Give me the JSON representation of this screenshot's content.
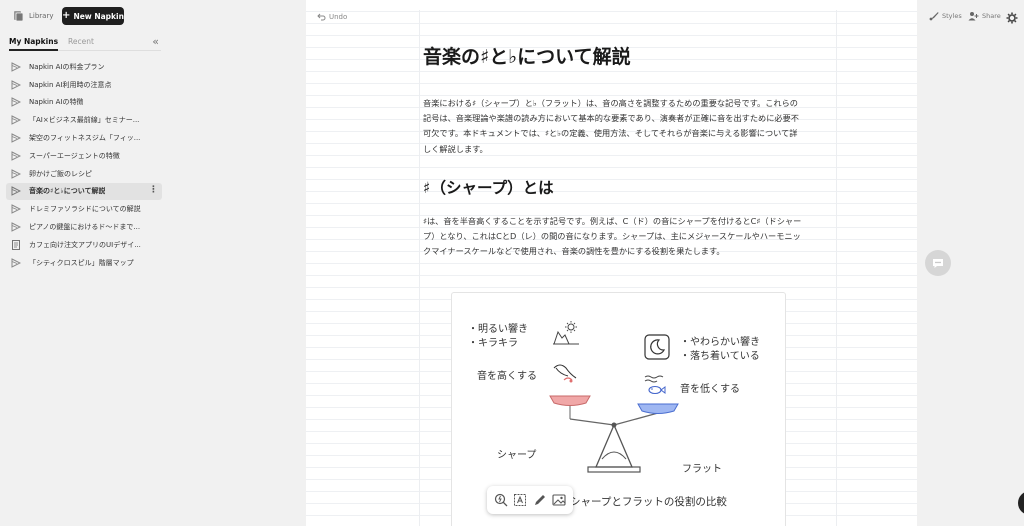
{
  "sidebar": {
    "library_label": "Library",
    "new_napkin_label": "New Napkin",
    "tabs": [
      {
        "label": "My Napkins",
        "active": true
      },
      {
        "label": "Recent",
        "active": false
      }
    ],
    "items": [
      {
        "label": "Napkin AIの料金プラン",
        "icon": "napkin-icon"
      },
      {
        "label": "Napkin AI利用時の注意点",
        "icon": "napkin-icon"
      },
      {
        "label": "Napkin AIの特徴",
        "icon": "napkin-icon"
      },
      {
        "label": "「AI×ビジネス最前線」セミナー...",
        "icon": "napkin-icon"
      },
      {
        "label": "架空のフィットネスジム「フィッ...",
        "icon": "napkin-icon"
      },
      {
        "label": "スーパーエージェントの特徴",
        "icon": "napkin-icon"
      },
      {
        "label": "卵かけご飯のレシピ",
        "icon": "napkin-icon"
      },
      {
        "label": "音楽の♯と♭について解説",
        "icon": "napkin-icon",
        "selected": true
      },
      {
        "label": "ドレミファソラシドについての解説",
        "icon": "napkin-icon"
      },
      {
        "label": "ピアノの鍵盤におけるド～ドまで...",
        "icon": "napkin-icon"
      },
      {
        "label": "カフェ向け注文アプリのUIデザイ...",
        "icon": "document-icon"
      },
      {
        "label": "「シティクロスピル」階層マップ",
        "icon": "napkin-icon"
      }
    ]
  },
  "document": {
    "undo_label": "Undo",
    "title": "音楽の♯と♭について解説",
    "intro": "音楽における♯（シャープ）と♭（フラット）は、音の高さを調整するための重要な記号です。これらの記号は、音楽理論や楽譜の読み方において基本的な要素であり、演奏者が正確に音を出すために必要不可欠です。本ドキュメントでは、♯と♭の定義、使用方法、そしてそれらが音楽に与える影響について詳しく解説します。",
    "section_heading": "♯（シャープ）とは",
    "section_body": "♯は、音を半音高くすることを示す記号です。例えば、C（ド）の音にシャープを付けるとC♯（ドシャープ）となり、これはCとD（レ）の間の音になります。シャープは、主にメジャースケールやハーモニックマイナースケールなどで使用され、音楽の調性を豊かにする役割を果たします。"
  },
  "figure": {
    "left_bullet_1": "・明るい響き",
    "left_bullet_2": "・キラキラ",
    "right_bullet_1": "・やわらかい響き",
    "right_bullet_2": "・落ち着いている",
    "raise_label": "音を高くする",
    "lower_label": "音を低くする",
    "sharp_label": "シャープ",
    "flat_label": "フラット",
    "caption": "シャープとフラットの役割の比較",
    "colors": {
      "left_pan": "#f0a7a7",
      "right_pan": "#9fb7f2"
    }
  },
  "topbar": {
    "styles_label": "Styles",
    "share_label": "Share"
  }
}
